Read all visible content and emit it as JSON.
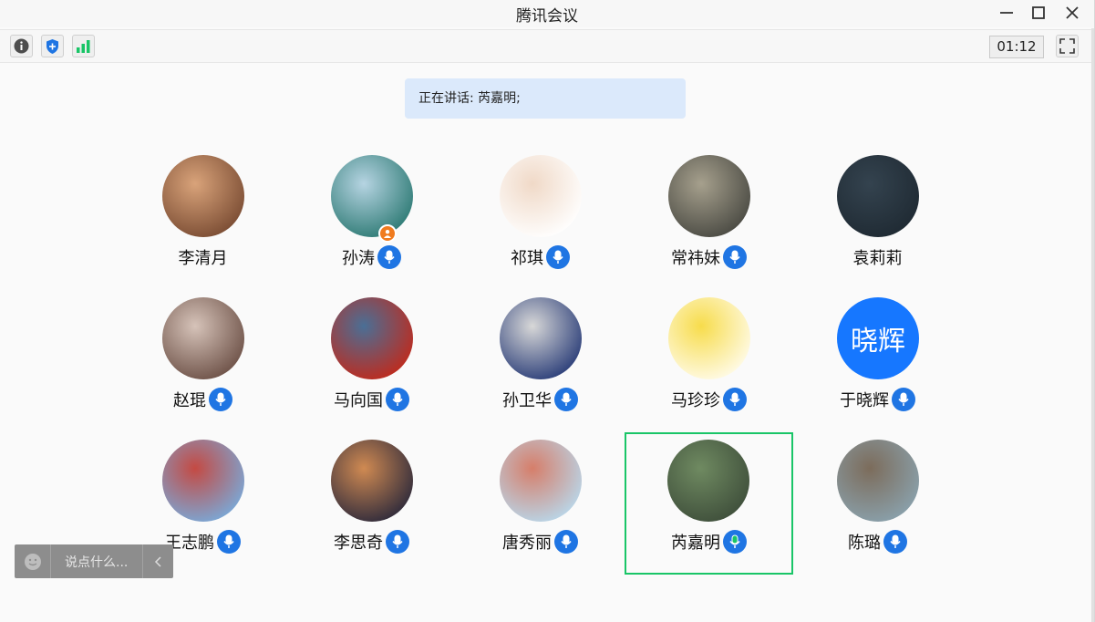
{
  "window": {
    "title": "腾讯会议"
  },
  "toolbar": {
    "timer": "01:12"
  },
  "speaking": {
    "text": "正在讲话: 芮嘉明;"
  },
  "participants": [
    {
      "name": "李清月",
      "avatar_colors": [
        "#7a4c33",
        "#d9a37a"
      ],
      "mic": false
    },
    {
      "name": "孙涛",
      "avatar_colors": [
        "#2d7a74",
        "#b6d4e2"
      ],
      "mic": true,
      "host_badge": true
    },
    {
      "name": "祁琪",
      "avatar_colors": [
        "#ffffff",
        "#f0d9c7"
      ],
      "mic": true
    },
    {
      "name": "常祎妹",
      "avatar_colors": [
        "#4a4a43",
        "#a6a08d"
      ],
      "mic": true
    },
    {
      "name": "袁莉莉",
      "avatar_colors": [
        "#1f2a33",
        "#34434f"
      ],
      "mic": false
    },
    {
      "name": "赵琨",
      "avatar_colors": [
        "#6d5147",
        "#d6c3b9"
      ],
      "mic": true
    },
    {
      "name": "马向国",
      "avatar_colors": [
        "#c02a1c",
        "#4a6f96"
      ],
      "mic": true
    },
    {
      "name": "孙卫华",
      "avatar_colors": [
        "#2a3d78",
        "#d8d8d8"
      ],
      "mic": true
    },
    {
      "name": "马珍珍",
      "avatar_colors": [
        "#fffbe9",
        "#f7dc4b"
      ],
      "mic": true
    },
    {
      "name": "于晓辉",
      "avatar_text": "晓辉",
      "avatar_colors": [
        "#1677ff",
        "#1677ff"
      ],
      "mic": true
    },
    {
      "name": "王志鹏",
      "avatar_colors": [
        "#7aa9d8",
        "#c44a43"
      ],
      "mic": true
    },
    {
      "name": "李思奇",
      "avatar_colors": [
        "#2e2a3b",
        "#d08a52"
      ],
      "mic": true
    },
    {
      "name": "唐秀丽",
      "avatar_colors": [
        "#b9d7ea",
        "#d67e6a"
      ],
      "mic": true
    },
    {
      "name": "芮嘉明",
      "avatar_colors": [
        "#3f4f3b",
        "#6f8a61"
      ],
      "mic": true,
      "speaking": true
    },
    {
      "name": "陈璐",
      "avatar_colors": [
        "#8aa1ac",
        "#7c6c5b"
      ],
      "mic": true
    }
  ],
  "chat": {
    "placeholder": "说点什么..."
  },
  "colors": {
    "accent": "#1f75e3",
    "speaking_green": "#19c567",
    "badge_orange": "#f07b1f"
  },
  "icons": [
    "info-icon",
    "security-shield-icon",
    "network-signal-icon",
    "fullscreen-icon",
    "minimize-icon",
    "maximize-icon",
    "close-icon",
    "microphone-icon",
    "emoji-icon",
    "collapse-chevron-icon",
    "host-user-icon"
  ]
}
